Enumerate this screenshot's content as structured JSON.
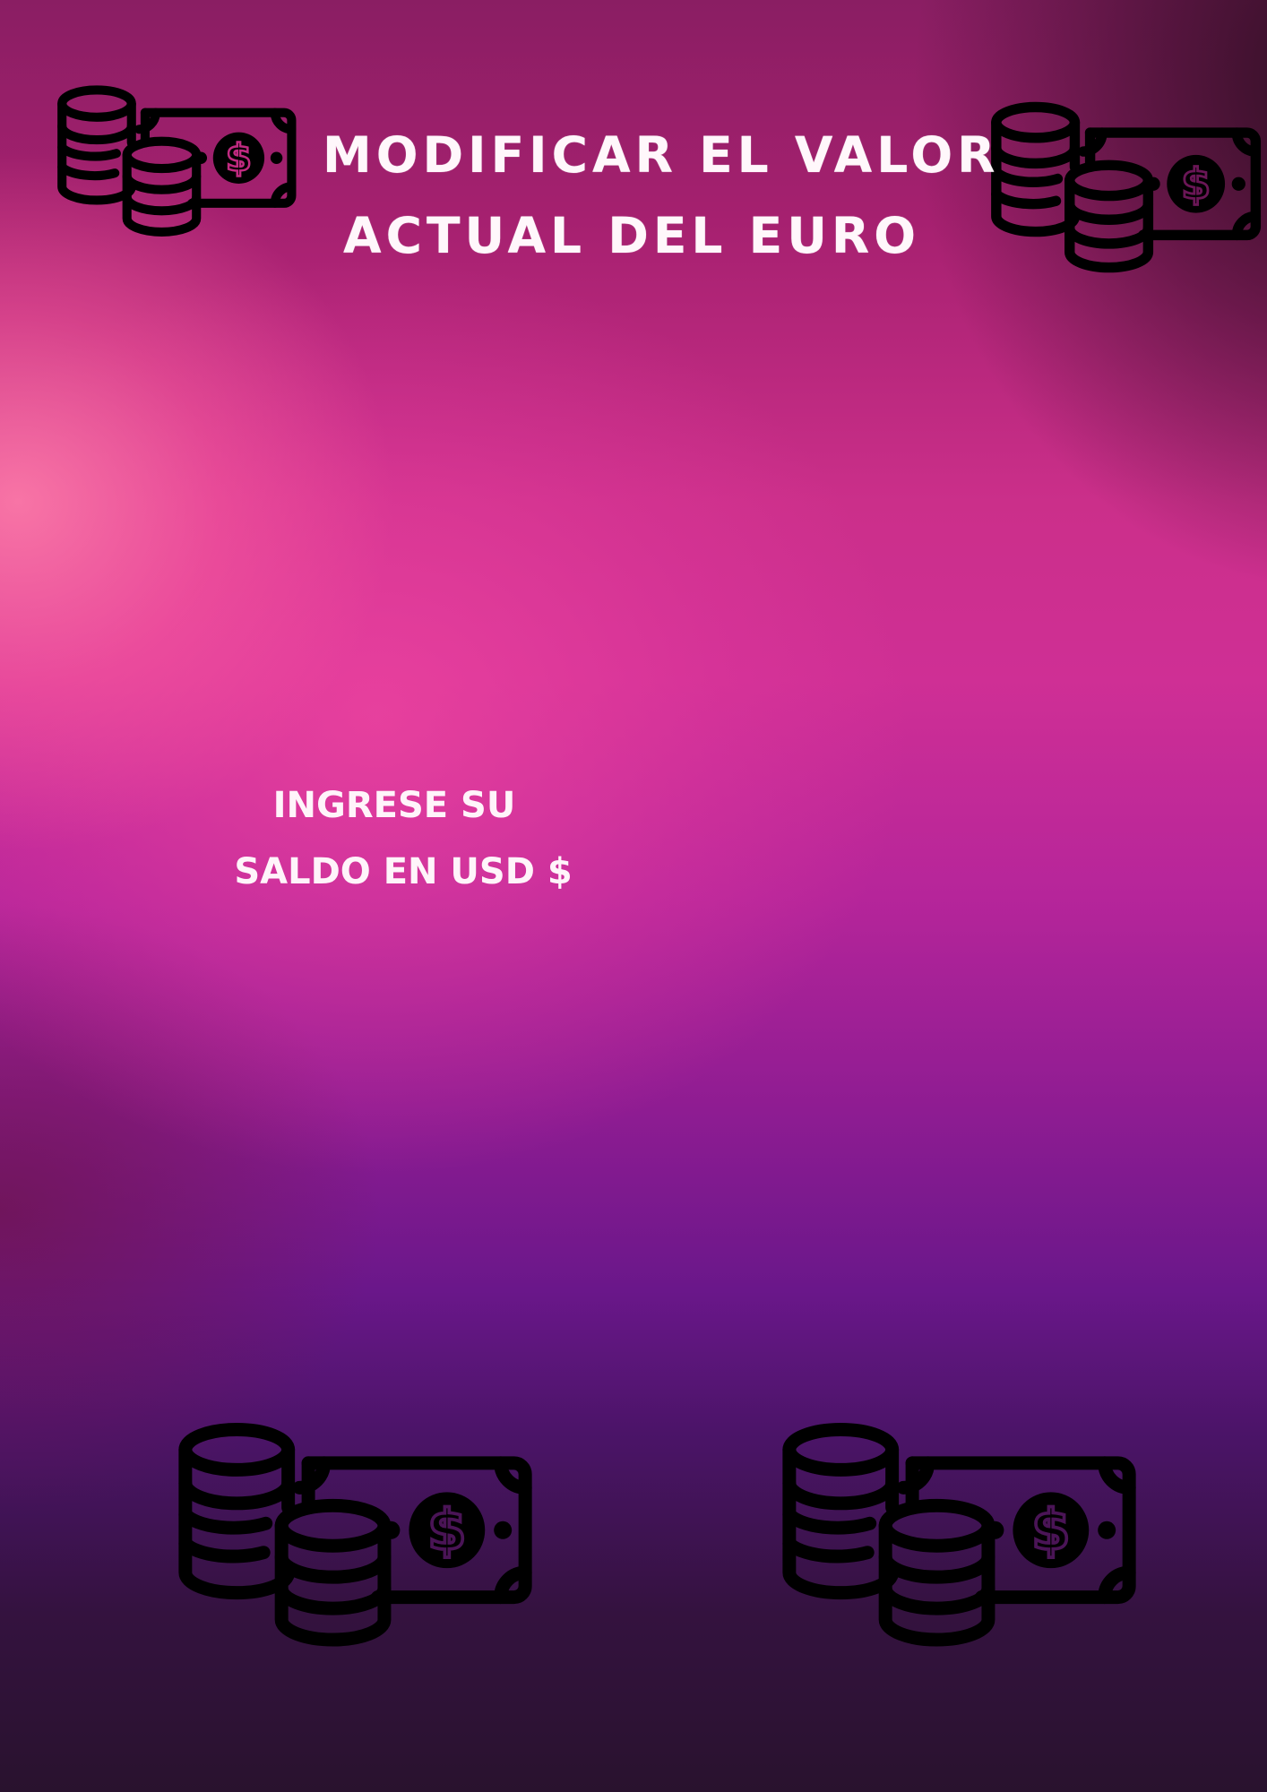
{
  "page": {
    "title_line1": "MODIFICAR EL VALOR",
    "title_line2": "ACTUAL DEL EURO",
    "prompt_line1": "INGRESE SU",
    "prompt_line2": "SALDO EN USD $"
  },
  "icons": {
    "money": "coins-and-banknote-icon",
    "currency_symbol": "$"
  },
  "colors": {
    "text": "#fff7fb",
    "icon": "#000000"
  }
}
